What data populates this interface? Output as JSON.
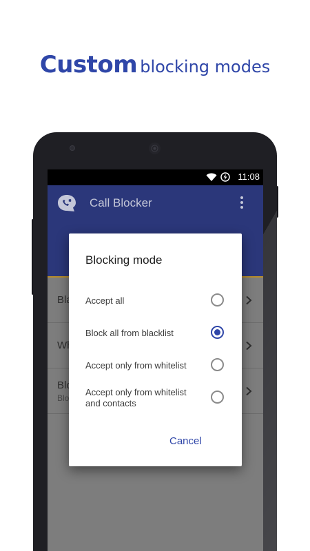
{
  "headline": {
    "bold": "Custom",
    "rest": "blocking modes"
  },
  "status_bar": {
    "time": "11:08",
    "icons": [
      "wifi-icon",
      "battery-charging-icon"
    ]
  },
  "app_bar": {
    "title": "Call Blocker",
    "icon": "call-blocker-logo-icon",
    "menu_icon": "overflow-menu-icon"
  },
  "background_list": {
    "rows": [
      {
        "title": "Bla",
        "subtitle": ""
      },
      {
        "title": "Wh",
        "subtitle": ""
      },
      {
        "title": "Blo",
        "subtitle": "Blo"
      }
    ]
  },
  "dialog": {
    "title": "Blocking mode",
    "options": [
      {
        "line1": "Accept all",
        "line2": "",
        "checked": false
      },
      {
        "line1": "Block all from blacklist",
        "line2": "",
        "checked": true
      },
      {
        "line1": "Accept only from whitelist",
        "line2": "",
        "checked": false
      },
      {
        "line1": "Accept only from whitelist",
        "line2": "and contacts",
        "checked": false
      }
    ],
    "cancel_label": "Cancel"
  },
  "colors": {
    "accent": "#2f46a8",
    "app_bar": "#2b377a",
    "status_bar": "#000000"
  }
}
